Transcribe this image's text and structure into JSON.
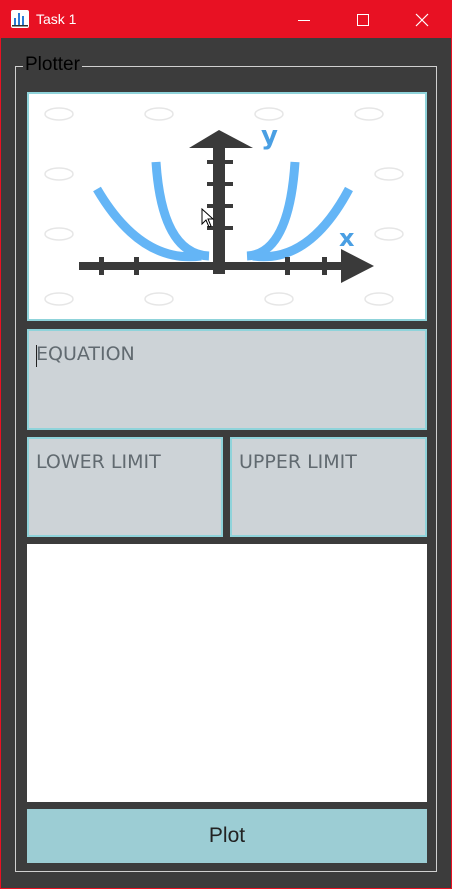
{
  "window": {
    "title": "Task 1",
    "icons": {
      "app": "chart-app-icon",
      "minimize": "minimize-icon",
      "maximize": "maximize-icon",
      "close": "close-icon"
    }
  },
  "group": {
    "title": "Plotter"
  },
  "image_panel": {
    "icon": "parabola-graph-illustration",
    "axis_labels": {
      "x": "x",
      "y": "y"
    }
  },
  "equation": {
    "placeholder": "EQUATION",
    "value": ""
  },
  "lower_limit": {
    "placeholder": "LOWER LIMIT",
    "value": ""
  },
  "upper_limit": {
    "placeholder": "UPPER LIMIT",
    "value": ""
  },
  "plot_button": {
    "label": "Plot"
  },
  "colors": {
    "titlebar": "#e81123",
    "panel_bg": "#3c3c3c",
    "field_bg": "#cdd3d7",
    "field_border": "#8fd3da",
    "button_bg": "#9ccdd4",
    "curve_blue": "#64b5f6",
    "axis_dark": "#3a3a3a"
  }
}
